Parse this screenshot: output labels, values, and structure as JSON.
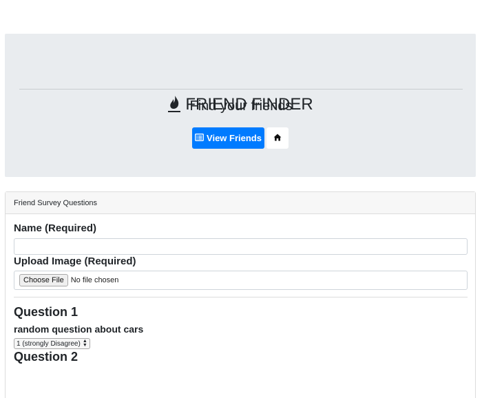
{
  "header": {
    "brand_title": "FRIEND FINDER",
    "brand_icon": "fire-icon",
    "tagline": "Find your friends",
    "view_friends_label": "View Friends",
    "view_friends_icon": "list-alt-icon",
    "home_icon": "home-icon"
  },
  "card": {
    "header": "Friend Survey Questions",
    "name_label": "Name (Required)",
    "name_value": "",
    "image_label": "Upload Image (Required)",
    "choose_file_label": "Choose File",
    "file_status": "No file chosen",
    "questions": [
      {
        "title": "Question 1",
        "text": "random question about cars",
        "selected": "1 (strongly Disagree)"
      },
      {
        "title": "Question 2"
      }
    ]
  },
  "colors": {
    "primary": "#007bff",
    "jumbotron_bg": "#e9ecef"
  }
}
